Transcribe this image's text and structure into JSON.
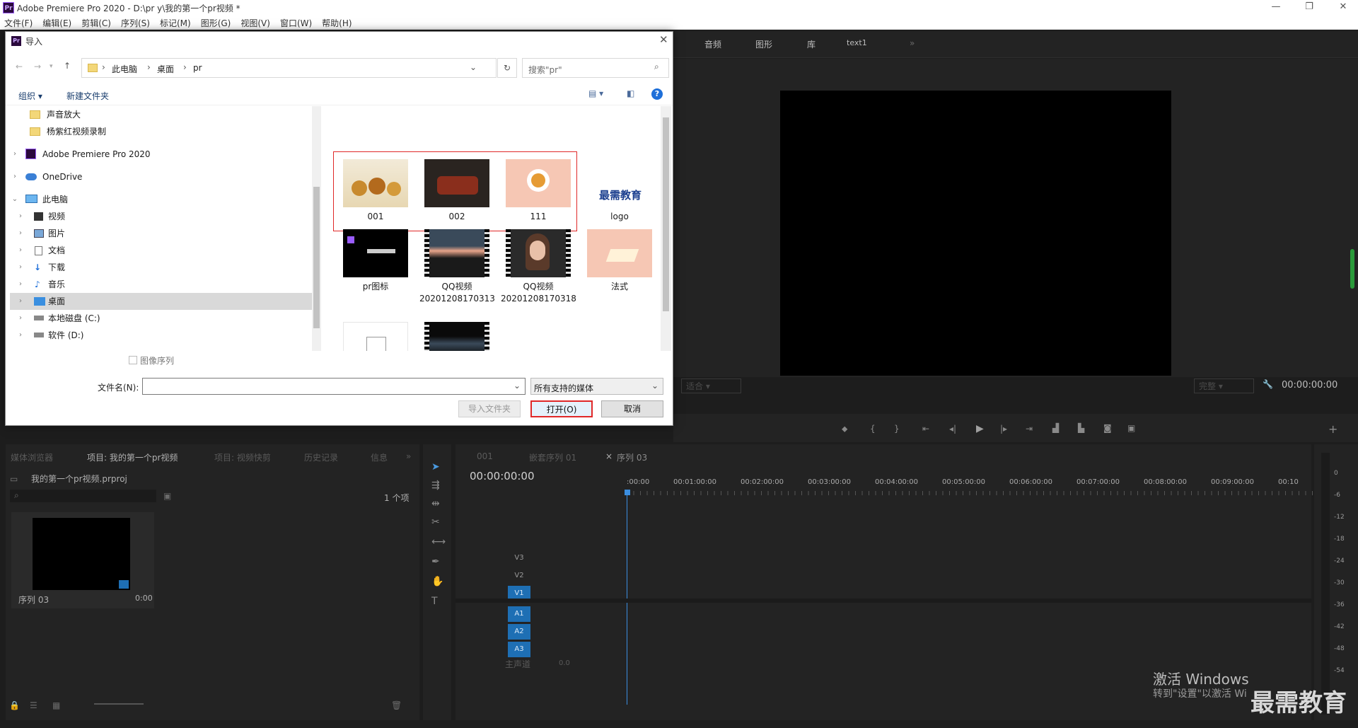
{
  "window": {
    "title": "Adobe Premiere Pro 2020 - D:\\pr y\\我的第一个pr视频 *",
    "app_badge": "Pr"
  },
  "menu": [
    "文件(F)",
    "编辑(E)",
    "剪辑(C)",
    "序列(S)",
    "标记(M)",
    "图形(G)",
    "视图(V)",
    "窗口(W)",
    "帮助(H)"
  ],
  "program_tabs": [
    "音频",
    "图形",
    "库",
    "text1"
  ],
  "program": {
    "fit": "适合",
    "quality": "完整",
    "timecode": "00:00:00:00"
  },
  "project": {
    "tabs": [
      "媒体浏览器",
      "项目: 我的第一个pr视频",
      "项目: 视频快剪",
      "历史记录",
      "信息"
    ],
    "file": "我的第一个pr视频.prproj",
    "count": "1 个项",
    "item_name": "序列 03",
    "item_dur": "0:00"
  },
  "timeline": {
    "tabs": [
      "001",
      "嵌套序列 01",
      "序列 03"
    ],
    "timecode": "00:00:00:00",
    "ruler": [
      ":00:00",
      "00:01:00:00",
      "00:02:00:00",
      "00:03:00:00",
      "00:04:00:00",
      "00:05:00:00",
      "00:06:00:00",
      "00:07:00:00",
      "00:08:00:00",
      "00:09:00:00",
      "00:10"
    ],
    "tracks": [
      "V3",
      "V2",
      "V1",
      "A1",
      "A2",
      "A3"
    ],
    "master": "主声道",
    "master_val": "0.0"
  },
  "meter": [
    "0",
    "-6",
    "-12",
    "-18",
    "-24",
    "-30",
    "-36",
    "-42",
    "-48",
    "-54"
  ],
  "dialog": {
    "title": "导入",
    "breadcrumb": [
      "此电脑",
      "桌面",
      "pr"
    ],
    "search_placeholder": "搜索\"pr\"",
    "organize": "组织 ▾",
    "new_folder": "新建文件夹",
    "tree": [
      {
        "label": "声音放大",
        "kind": "folder"
      },
      {
        "label": "杨紫红视频录制",
        "kind": "folder"
      },
      {
        "label": "Adobe Premiere Pro 2020",
        "kind": "pr"
      },
      {
        "label": "OneDrive",
        "kind": "cloud"
      },
      {
        "label": "此电脑",
        "kind": "pc"
      },
      {
        "label": "视频",
        "kind": "video"
      },
      {
        "label": "图片",
        "kind": "pic"
      },
      {
        "label": "文档",
        "kind": "doc"
      },
      {
        "label": "下载",
        "kind": "down"
      },
      {
        "label": "音乐",
        "kind": "music"
      },
      {
        "label": "桌面",
        "kind": "desk"
      },
      {
        "label": "本地磁盘 (C:)",
        "kind": "disk"
      },
      {
        "label": "软件 (D:)",
        "kind": "disk"
      }
    ],
    "files": [
      {
        "name": "001"
      },
      {
        "name": "002"
      },
      {
        "name": "111"
      },
      {
        "name": "logo",
        "logo_text": "最需教育"
      },
      {
        "name": "pr图标"
      },
      {
        "name": "QQ视频20201208170313"
      },
      {
        "name": "QQ视频20201208170318"
      },
      {
        "name": "法式"
      },
      {
        "name": ""
      },
      {
        "name": ""
      }
    ],
    "image_sequence": "图像序列",
    "filename_label": "文件名(N):",
    "filetype": "所有支持的媒体",
    "import_folder": "导入文件夹",
    "open": "打开(O)",
    "cancel": "取消"
  },
  "watermark": {
    "line1": "激活 Windows",
    "line2": "转到\"设置\"以激活 Wi",
    "brand": "最需教育"
  }
}
